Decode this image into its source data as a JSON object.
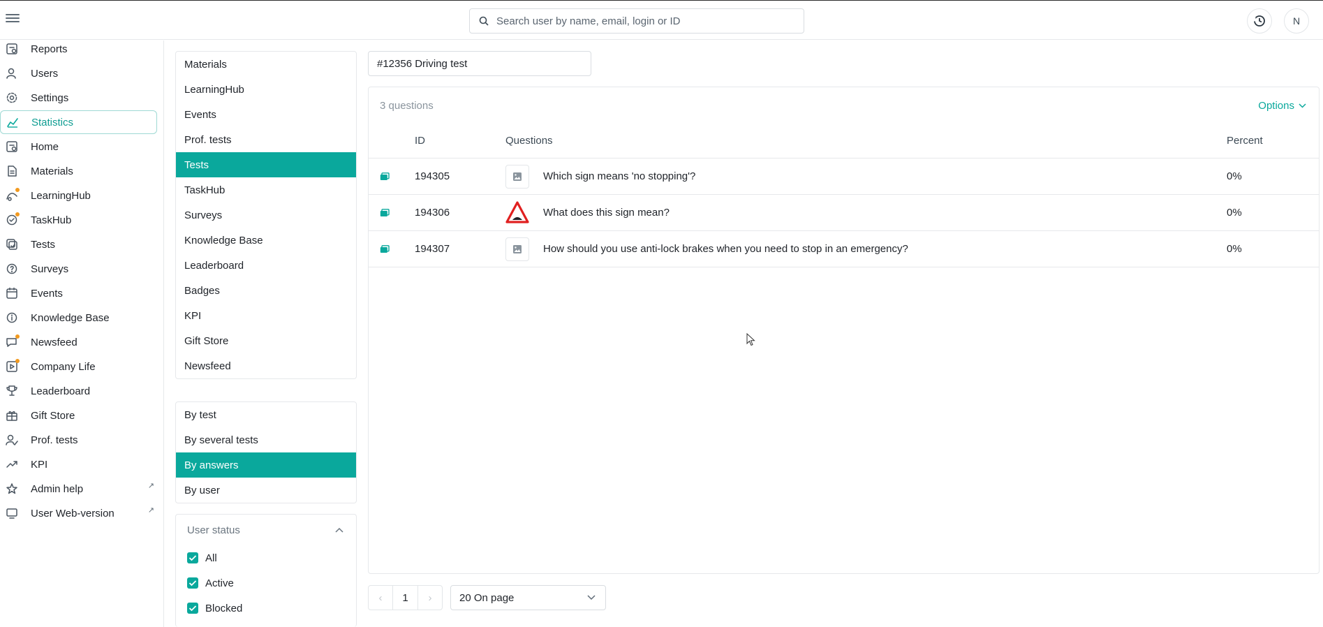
{
  "header": {
    "search_placeholder": "Search user by name, email, login or ID",
    "avatar_initial": "N"
  },
  "nav": {
    "items": [
      {
        "label": "Reports",
        "icon": "reports-icon"
      },
      {
        "label": "Users",
        "icon": "users-icon"
      },
      {
        "label": "Settings",
        "icon": "gear-icon"
      },
      {
        "label": "Statistics",
        "icon": "chart-line-icon",
        "active": true
      },
      {
        "label": "Home",
        "icon": "home-icon"
      },
      {
        "label": "Materials",
        "icon": "document-icon"
      },
      {
        "label": "LearningHub",
        "icon": "learning-icon",
        "badge": true
      },
      {
        "label": "TaskHub",
        "icon": "task-icon",
        "badge": true
      },
      {
        "label": "Tests",
        "icon": "tests-icon"
      },
      {
        "label": "Surveys",
        "icon": "survey-icon"
      },
      {
        "label": "Events",
        "icon": "calendar-icon"
      },
      {
        "label": "Knowledge Base",
        "icon": "info-icon"
      },
      {
        "label": "Newsfeed",
        "icon": "chat-icon",
        "badge": true
      },
      {
        "label": "Company Life",
        "icon": "company-life-icon",
        "badge": true
      },
      {
        "label": "Leaderboard",
        "icon": "trophy-icon"
      },
      {
        "label": "Gift Store",
        "icon": "gift-icon"
      },
      {
        "label": "Prof. tests",
        "icon": "prof-test-icon"
      },
      {
        "label": "KPI",
        "icon": "trend-icon"
      },
      {
        "label": "Admin help",
        "icon": "star-icon",
        "external": true
      },
      {
        "label": "User Web-version",
        "icon": "monitor-icon",
        "external": true
      }
    ],
    "external_glyph": "↗"
  },
  "sections": {
    "items": [
      "Materials",
      "LearningHub",
      "Events",
      "Prof. tests",
      "Tests",
      "TaskHub",
      "Surveys",
      "Knowledge Base",
      "Leaderboard",
      "Badges",
      "KPI",
      "Gift Store",
      "Newsfeed"
    ],
    "selected": "Tests"
  },
  "report_types": {
    "items": [
      "By test",
      "By several tests",
      "By answers",
      "By user"
    ],
    "selected": "By answers"
  },
  "user_status": {
    "title": "User status",
    "options": [
      {
        "label": "All",
        "checked": true
      },
      {
        "label": "Active",
        "checked": true
      },
      {
        "label": "Blocked",
        "checked": true
      }
    ]
  },
  "main": {
    "test_selector": "#12356 Driving test",
    "question_count": "3 questions",
    "options_label": "Options",
    "columns": {
      "id": "ID",
      "questions": "Questions",
      "percent": "Percent"
    },
    "rows": [
      {
        "id": "194305",
        "question": "Which sign means 'no stopping'?",
        "percent": "0%",
        "thumb": "image-placeholder-icon"
      },
      {
        "id": "194306",
        "question": "What does this sign mean?",
        "percent": "0%",
        "thumb": "warning-sign-icon"
      },
      {
        "id": "194307",
        "question": "How should you use anti-lock brakes when you need to stop in an emergency?",
        "percent": "0%",
        "thumb": "image-placeholder-icon"
      }
    ]
  },
  "pagination": {
    "prev": "‹",
    "page": "1",
    "next": "›",
    "per_page": "20 On page"
  },
  "colors": {
    "accent": "#0aa89c",
    "badge": "#f29a1f",
    "warning_red": "#e02020"
  }
}
